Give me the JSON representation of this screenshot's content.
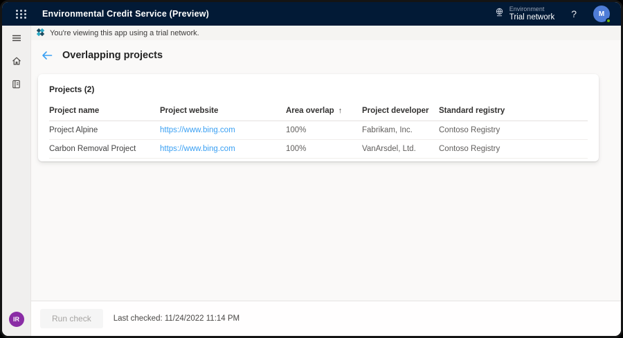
{
  "topbar": {
    "app_title": "Environmental Credit Service (Preview)",
    "environment_label": "Environment",
    "environment_value": "Trial network",
    "help_label": "?",
    "avatar_initial": "M"
  },
  "banner": {
    "message": "You're viewing this app using a trial network."
  },
  "sidebar": {
    "avatar_initials": "IR"
  },
  "page": {
    "title": "Overlapping projects"
  },
  "projects": {
    "card_title": "Projects (2)",
    "columns": [
      "Project name",
      "Project website",
      "Area overlap",
      "Project developer",
      "Standard registry"
    ],
    "sort_arrow": "↑",
    "rows": [
      {
        "name": "Project Alpine",
        "website": "https://www.bing.com",
        "overlap": "100%",
        "developer": "Fabrikam, Inc.",
        "registry": "Contoso Registry"
      },
      {
        "name": "Carbon Removal Project",
        "website": "https://www.bing.com",
        "overlap": "100%",
        "developer": "VanArsdel, Ltd.",
        "registry": "Contoso Registry"
      }
    ]
  },
  "footer": {
    "run_check_label": "Run check",
    "last_checked": "Last checked: 11/24/2022 11:14 PM"
  },
  "colors": {
    "topbar": "#021a36",
    "link": "#3aa0f3",
    "avatar_m": "#4e7cd6",
    "avatar_ir": "#8a2da5",
    "presence": "#6bb700",
    "content_bg": "#faf9f8"
  }
}
